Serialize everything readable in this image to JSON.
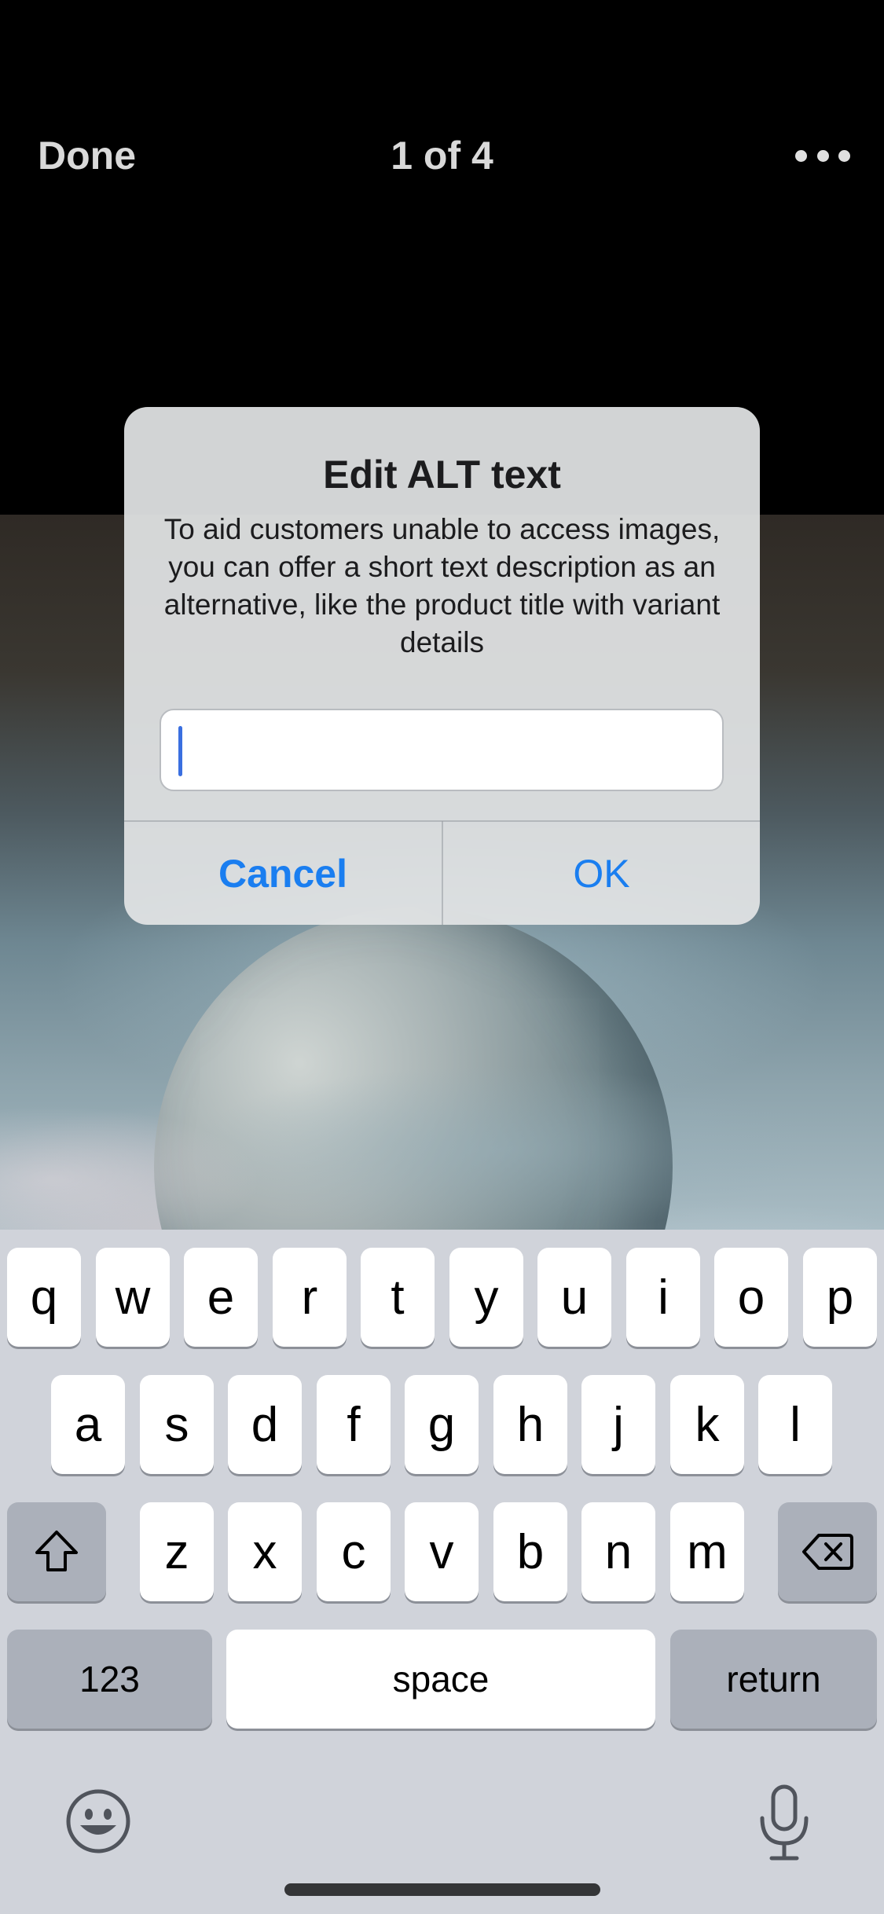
{
  "nav": {
    "done_label": "Done",
    "title": "1 of 4",
    "more_icon": "ellipsis-icon"
  },
  "alert": {
    "title": "Edit ALT text",
    "message": "To aid customers unable to access images, you can offer a short text description as an alternative, like the product title with variant details",
    "input_value": "",
    "input_placeholder": "",
    "cancel_label": "Cancel",
    "ok_label": "OK",
    "accent_color": "#1a7ef0"
  },
  "keyboard": {
    "row1": [
      "q",
      "w",
      "e",
      "r",
      "t",
      "y",
      "u",
      "i",
      "o",
      "p"
    ],
    "row2": [
      "a",
      "s",
      "d",
      "f",
      "g",
      "h",
      "j",
      "k",
      "l"
    ],
    "row3": [
      "z",
      "x",
      "c",
      "v",
      "b",
      "n",
      "m"
    ],
    "numbers_label": "123",
    "space_label": "space",
    "return_label": "return",
    "shift_icon": "shift-icon",
    "delete_icon": "backspace-icon",
    "emoji_icon": "emoji-icon",
    "mic_icon": "microphone-icon"
  }
}
